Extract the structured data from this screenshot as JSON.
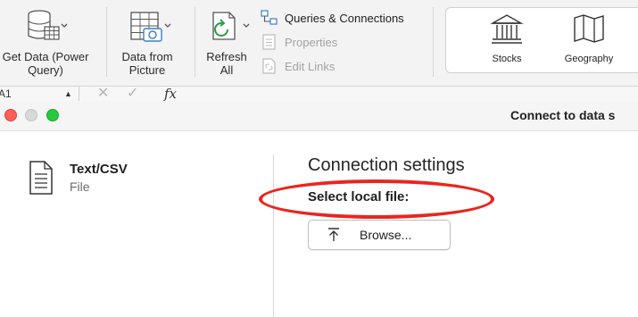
{
  "ribbon": {
    "get_data": {
      "line1": "Get Data (Power",
      "line2": "Query)"
    },
    "data_from_picture": {
      "line1": "Data from",
      "line2": "Picture"
    },
    "refresh_all": {
      "line1": "Refresh",
      "line2": "All"
    },
    "queries": [
      {
        "label": "Queries & Connections",
        "icon": "queries-icon",
        "enabled": true
      },
      {
        "label": "Properties",
        "icon": "properties-icon",
        "enabled": false
      },
      {
        "label": "Edit Links",
        "icon": "edit-links-icon",
        "enabled": false
      }
    ],
    "data_types": [
      {
        "label": "Stocks",
        "icon": "bank-icon"
      },
      {
        "label": "Geography",
        "icon": "map-icon"
      }
    ]
  },
  "formula_bar": {
    "name_box": "A1",
    "fx": "fx"
  },
  "dialog": {
    "title": "Connect to data s",
    "source": {
      "name": "Text/CSV",
      "type": "File"
    },
    "settings_title": "Connection settings",
    "select_label": "Select local file:",
    "browse_label": "Browse...",
    "highlight_color": "#e8261e"
  }
}
